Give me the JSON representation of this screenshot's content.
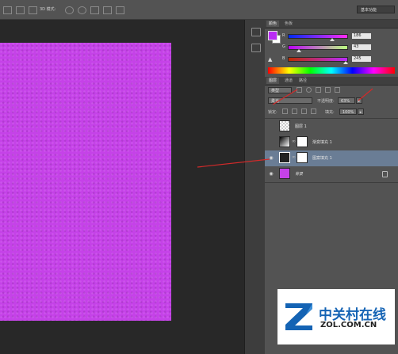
{
  "options_bar": {
    "mode_3d_label": "3D 模式:",
    "workspace": "基本功能"
  },
  "color_panel": {
    "tabs": [
      "颜色",
      "色板"
    ],
    "channels": [
      {
        "name": "R",
        "value": "186",
        "fill": 0.73
      },
      {
        "name": "G",
        "value": "43",
        "fill": 0.17
      },
      {
        "name": "B",
        "value": "245",
        "fill": 0.96
      }
    ],
    "fg_color": "#ba2bf5",
    "bg_color": "#ffffff"
  },
  "layers_panel": {
    "tabs": [
      "图层",
      "通道",
      "路径"
    ],
    "filter_kind": "类型",
    "blend_mode": "柔光",
    "opacity_label": "不透明度:",
    "opacity_value": "63%",
    "lock_label": "锁定:",
    "fill_label": "填充:",
    "fill_value": "100%",
    "layers": [
      {
        "name": "图层 1",
        "visible": false,
        "thumb": "checker"
      },
      {
        "name": "渐变填充 1",
        "visible": false,
        "thumb": "gradient"
      },
      {
        "name": "图案填充 1",
        "visible": true,
        "thumb": "pattern",
        "selected": true
      },
      {
        "name": "背景",
        "visible": true,
        "thumb": "purple",
        "locked": true
      }
    ]
  },
  "canvas": {
    "fill_color": "#c542e8"
  },
  "watermark": {
    "brand_cn": "中关村在线",
    "brand_url": "ZOL.COM.CN"
  },
  "annotation_color": "#d32a2a"
}
